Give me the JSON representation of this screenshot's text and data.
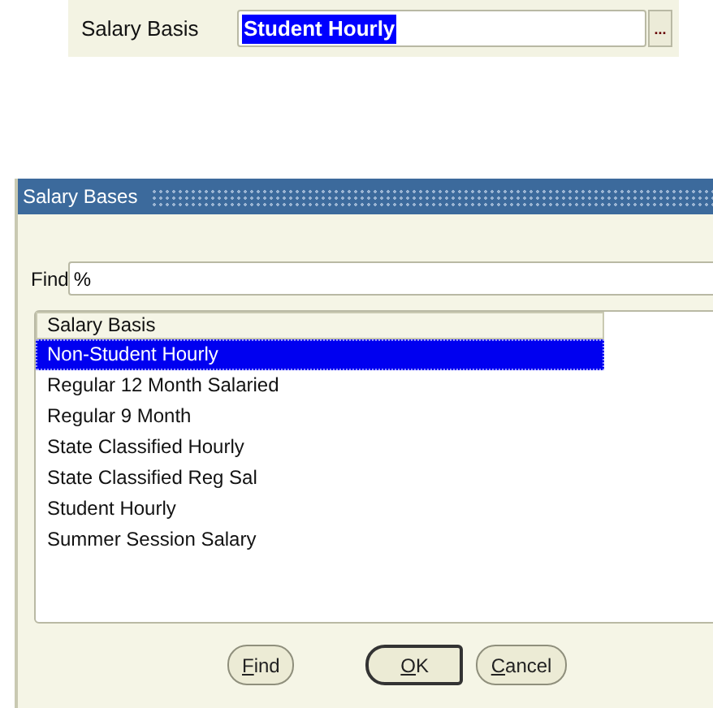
{
  "form": {
    "label": "Salary Basis",
    "value": "Student Hourly",
    "value_selected": true,
    "lookup_button": "..."
  },
  "dialog": {
    "title": "Salary Bases",
    "find": {
      "label": "Find",
      "value": "%"
    },
    "list": {
      "column": "Salary Basis",
      "rows": [
        {
          "text": "Non-Student Hourly",
          "selected": true
        },
        {
          "text": "Regular 12 Month Salaried",
          "selected": false
        },
        {
          "text": "Regular 9 Month",
          "selected": false
        },
        {
          "text": "State Classified Hourly",
          "selected": false
        },
        {
          "text": "State Classified Reg Sal",
          "selected": false
        },
        {
          "text": "Student Hourly",
          "selected": false
        },
        {
          "text": "Summer Session Salary",
          "selected": false
        }
      ]
    },
    "buttons": [
      {
        "label": "Find",
        "default": false,
        "underline_first": true
      },
      {
        "label": "OK",
        "default": true,
        "underline_first": true
      },
      {
        "label": "Cancel",
        "default": false,
        "underline_first": true
      }
    ]
  }
}
